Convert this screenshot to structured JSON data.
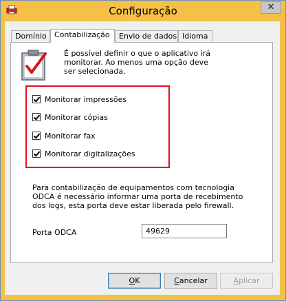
{
  "window": {
    "title": "Configuração",
    "close_glyph": "✕"
  },
  "tabs": [
    {
      "label": "Domínio",
      "active": false
    },
    {
      "label": "Contabilização",
      "active": true
    },
    {
      "label": "Envio de dados",
      "active": false
    },
    {
      "label": "Idioma",
      "active": false
    }
  ],
  "intro_text": "É possível definir o que o aplicativo irá monitorar. Ao menos uma opção deve ser selecionada.",
  "options": [
    {
      "label": "Monitorar impressões",
      "checked": true
    },
    {
      "label": "Monitorar cópias",
      "checked": true
    },
    {
      "label": "Monitorar fax",
      "checked": true
    },
    {
      "label": "Monitorar digitalizações",
      "checked": true
    }
  ],
  "odca_text": "Para contabilização de equipamentos com tecnologia ODCA é necessário informar uma porta de recebimento dos logs, esta porta deve estar liberada pelo firewall.",
  "porta": {
    "label": "Porta  ODCA",
    "value": "49629"
  },
  "buttons": {
    "ok_first": "O",
    "ok_rest": "K",
    "cancel_first": "C",
    "cancel_rest": "ancelar",
    "apply_first": "A",
    "apply_rest": "plicar"
  },
  "colors": {
    "title_bar": "#f5c046",
    "highlight": "#e30e1c"
  },
  "icons": {
    "app": "printer-icon",
    "doc": "checklist-clipboard-icon"
  }
}
